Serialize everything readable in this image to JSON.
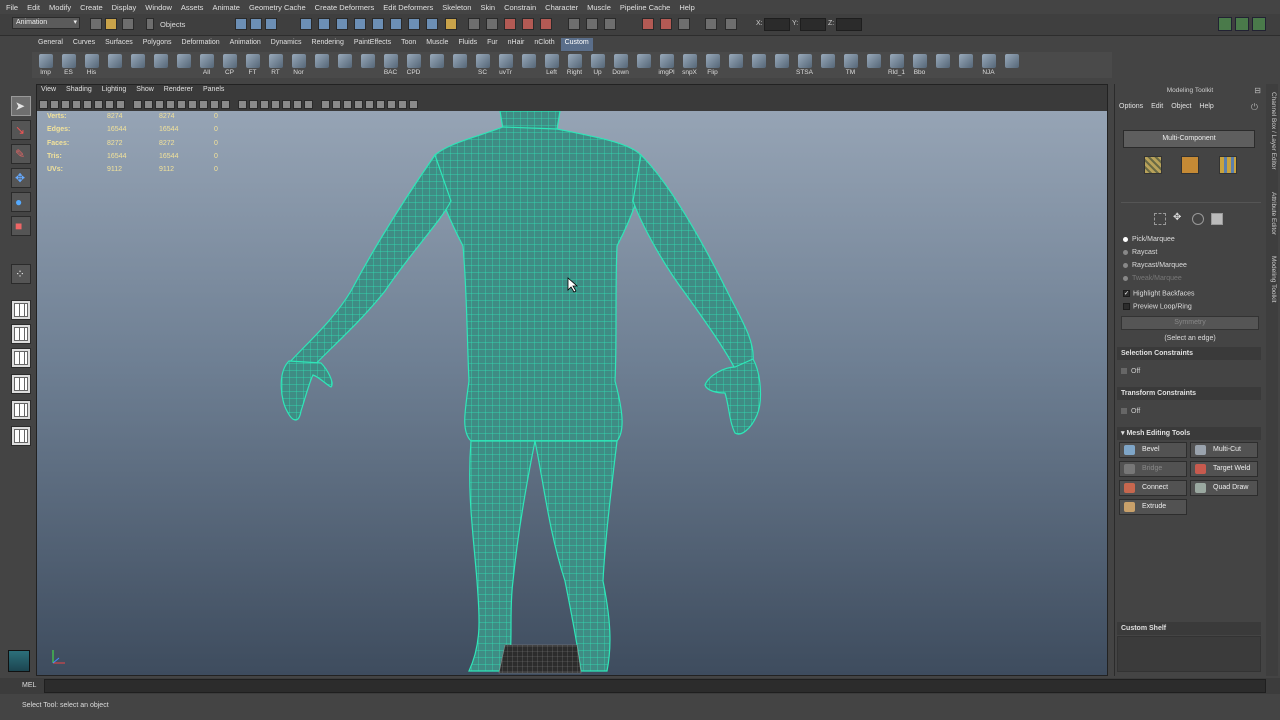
{
  "menubar": [
    "File",
    "Edit",
    "Modify",
    "Create",
    "Display",
    "Window",
    "Assets",
    "Animate",
    "Geometry Cache",
    "Create Deformers",
    "Edit Deformers",
    "Skeleton",
    "Skin",
    "Constrain",
    "Character",
    "Muscle",
    "Pipeline Cache",
    "Help"
  ],
  "statusline": {
    "mode": "Animation",
    "selection_mask_label": "Objects",
    "coord_labels": [
      "X:",
      "Y:",
      "Z:"
    ]
  },
  "shelf_tabs": [
    "General",
    "Curves",
    "Surfaces",
    "Polygons",
    "Deformation",
    "Animation",
    "Dynamics",
    "Rendering",
    "PaintEffects",
    "Toon",
    "Muscle",
    "Fluids",
    "Fur",
    "nHair",
    "nCloth",
    "Custom"
  ],
  "active_shelf_tab": "Custom",
  "shelf_buttons": [
    "Imp",
    "ES",
    "His",
    "",
    "",
    "",
    "",
    "All",
    "CP",
    "FT",
    "RT",
    "Nor",
    "",
    "",
    "",
    "BAC",
    "CPD",
    "",
    "",
    "SC",
    "uvTr",
    "",
    "Left",
    "Right",
    "Up",
    "Down",
    "",
    "imgPl",
    "snpX",
    "Flip",
    "",
    "",
    "",
    "STSA",
    "",
    "TM",
    "",
    "Rld_1",
    "Bbo",
    "",
    "",
    "NJA",
    ""
  ],
  "panel_menu": [
    "View",
    "Shading",
    "Lighting",
    "Show",
    "Renderer",
    "Panels"
  ],
  "hud": [
    {
      "label": "Verts:",
      "v1": "8274",
      "v2": "8274",
      "v3": "0"
    },
    {
      "label": "Edges:",
      "v1": "16544",
      "v2": "16544",
      "v3": "0"
    },
    {
      "label": "Faces:",
      "v1": "8272",
      "v2": "8272",
      "v3": "0"
    },
    {
      "label": "Tris:",
      "v1": "16544",
      "v2": "16544",
      "v3": "0"
    },
    {
      "label": "UVs:",
      "v1": "9112",
      "v2": "9112",
      "v3": "0"
    }
  ],
  "cmdline": {
    "label": "MEL"
  },
  "helpline": {
    "text": "Select Tool: select an object"
  },
  "toolkit": {
    "title": "Modeling Toolkit",
    "menu": [
      "Options",
      "Edit",
      "Object",
      "Help"
    ],
    "multi_component": "Multi-Component",
    "pick_modes": [
      "Pick/Marquee",
      "Raycast",
      "Raycast/Marquee",
      "Tweak/Marquee"
    ],
    "checks": [
      "Highlight Backfaces",
      "Preview Loop/Ring"
    ],
    "symmetry": "Symmetry",
    "select_hint": "(Select an edge)",
    "selection_constraints": {
      "header": "Selection Constraints",
      "value": "Off"
    },
    "transform_constraints": {
      "header": "Transform Constraints",
      "value": "Off"
    },
    "mesh_editing": {
      "header": "Mesh Editing Tools",
      "buttons": [
        "Bevel",
        "Multi-Cut",
        "Bridge",
        "Target Weld",
        "Connect",
        "Quad Draw",
        "Extrude"
      ]
    },
    "custom_shelf": "Custom Shelf"
  },
  "side_tabs": [
    "Channel Box / Layer Editor",
    "Attribute Editor",
    "Modeling Toolkit"
  ],
  "colors": {
    "wireframe": "#2fe6b8",
    "hud_text": "#f2e29a",
    "active_tab": "#5a6e8a",
    "viewport_top": "#96a4b5",
    "viewport_bottom": "#3e4c5e"
  }
}
